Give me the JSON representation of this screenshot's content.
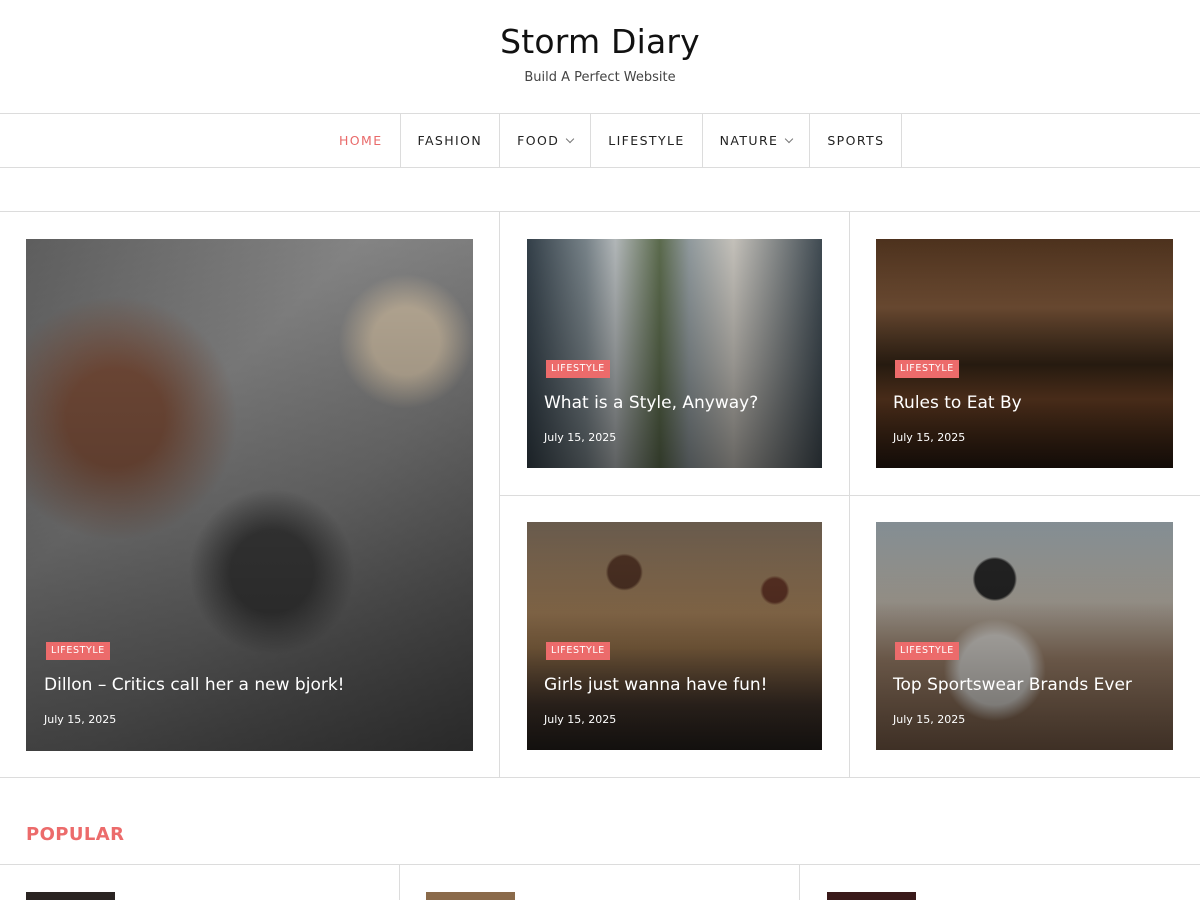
{
  "site": {
    "title": "Storm Diary",
    "tagline": "Build A Perfect Website"
  },
  "nav": {
    "items": [
      {
        "label": "HOME",
        "active": true,
        "has_dropdown": false
      },
      {
        "label": "FASHION",
        "active": false,
        "has_dropdown": false
      },
      {
        "label": "FOOD",
        "active": false,
        "has_dropdown": true
      },
      {
        "label": "LIFESTYLE",
        "active": false,
        "has_dropdown": false
      },
      {
        "label": "NATURE",
        "active": false,
        "has_dropdown": true
      },
      {
        "label": "SPORTS",
        "active": false,
        "has_dropdown": false
      }
    ]
  },
  "featured": {
    "posts": [
      {
        "category": "LIFESTYLE",
        "title": "Dillon – Critics call her a new bjork!",
        "date": "July 15, 2025"
      },
      {
        "category": "LIFESTYLE",
        "title": "What is a Style, Anyway?",
        "date": "July 15, 2025"
      },
      {
        "category": "LIFESTYLE",
        "title": "Rules to Eat By",
        "date": "July 15, 2025"
      },
      {
        "category": "LIFESTYLE",
        "title": "Girls just wanna have fun!",
        "date": "July 15, 2025"
      },
      {
        "category": "LIFESTYLE",
        "title": "Top Sportswear Brands Ever",
        "date": "July 15, 2025"
      }
    ]
  },
  "popular": {
    "heading": "POPULAR"
  },
  "colors": {
    "accent": "#ec6b6b",
    "border": "#dcdcdc",
    "text": "#222222"
  }
}
